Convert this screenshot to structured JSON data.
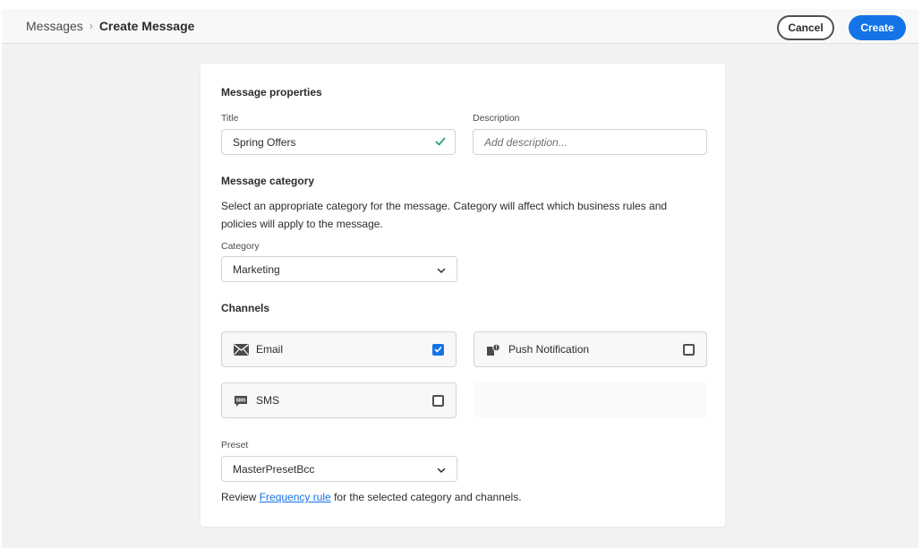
{
  "breadcrumb": {
    "root": "Messages",
    "separator": "›",
    "current": "Create Message"
  },
  "header_actions": {
    "cancel_label": "Cancel",
    "create_label": "Create"
  },
  "message_properties": {
    "heading": "Message properties",
    "title_label": "Title",
    "title_value": "Spring Offers",
    "description_label": "Description",
    "description_placeholder": "Add description..."
  },
  "message_category": {
    "heading": "Message category",
    "description": "Select an appropriate category for the message. Category will affect which business rules and policies will apply to the message.",
    "category_label": "Category",
    "category_value": "Marketing"
  },
  "channels": {
    "heading": "Channels",
    "items": [
      {
        "label": "Email",
        "icon": "envelope-icon",
        "checked": true
      },
      {
        "label": "Push Notification",
        "icon": "push-notification-icon",
        "checked": false
      },
      {
        "label": "SMS",
        "icon": "sms-icon",
        "checked": false
      }
    ]
  },
  "preset": {
    "label": "Preset",
    "value": "MasterPresetBcc"
  },
  "review": {
    "prefix": "Review ",
    "link": "Frequency rule",
    "suffix": " for the selected category and channels."
  },
  "colors": {
    "accent": "#1473e6",
    "valid_check": "#2d9d78",
    "page_bg": "#f2f2f2"
  }
}
